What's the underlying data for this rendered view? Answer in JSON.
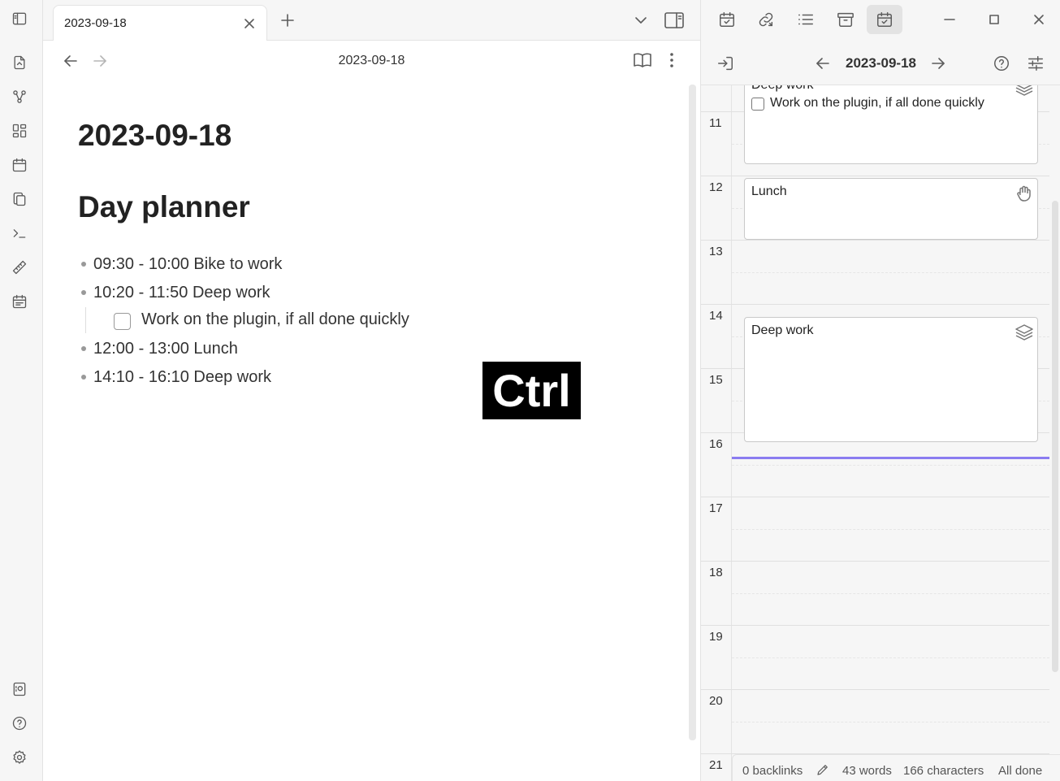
{
  "tab": {
    "title": "2023-09-18"
  },
  "view": {
    "title": "2023-09-18"
  },
  "document": {
    "heading1": "2023-09-18",
    "heading2": "Day planner",
    "list": [
      {
        "text": "09:30 - 10:00 Bike to work"
      },
      {
        "text": "10:20 - 11:50 Deep work"
      },
      {
        "text": "12:00 - 13:00 Lunch"
      },
      {
        "text": "14:10 - 16:10 Deep work"
      }
    ],
    "subtask": {
      "text": "Work on the plugin, if all done quickly",
      "checked": false
    }
  },
  "overlay": {
    "key": "Ctrl"
  },
  "planner": {
    "date": "2023-09-18",
    "hours": [
      "11",
      "12",
      "13",
      "14",
      "15",
      "16",
      "17",
      "18",
      "19",
      "20",
      "21"
    ],
    "events": [
      {
        "title": "Deep work",
        "task": "Work on the plugin, if all done quickly",
        "icon": "layers-icon"
      },
      {
        "title": "Lunch",
        "icon": "grab-hand-icon"
      },
      {
        "title": "Deep work",
        "icon": "layers-icon"
      }
    ],
    "now_line_color": "#8a7cf0"
  },
  "status_bar": {
    "backlinks": "0 backlinks",
    "words": "43 words",
    "characters": "166 characters",
    "tasks": "All done"
  }
}
